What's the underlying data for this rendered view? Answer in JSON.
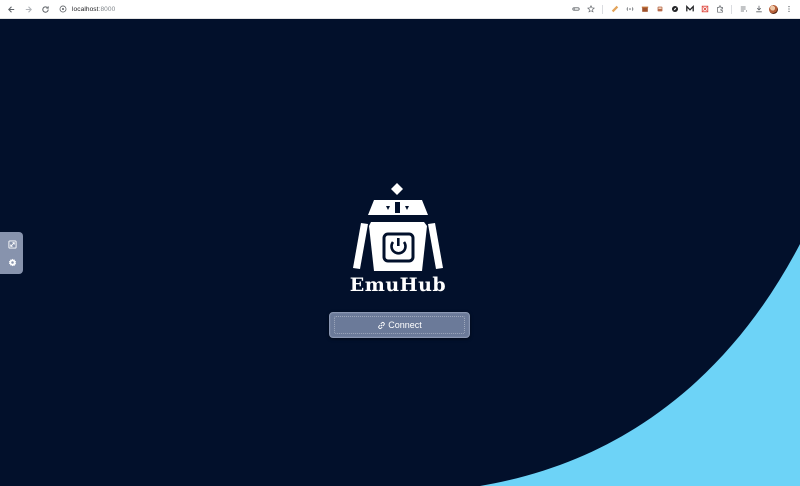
{
  "browser": {
    "url_host": "localhost",
    "url_port": ":8000",
    "icons": {
      "back": "back-arrow-icon",
      "forward": "forward-arrow-icon",
      "reload": "reload-icon",
      "site_info": "site-info-icon",
      "password_key": "key-icon",
      "bookmark": "star-icon",
      "extensions": "puzzle-icon",
      "downloads": "download-icon",
      "menu": "kebab-menu-icon"
    }
  },
  "app": {
    "brand_name": "EmuHub",
    "connect_label": "Connect",
    "colors": {
      "background": "#02102b",
      "wave": "#6dd3f7",
      "button": "#6b7a99",
      "panel": "#8793ad"
    },
    "side_panel": {
      "buttons": [
        "fullscreen-toggle-icon",
        "settings-gear-icon"
      ]
    }
  }
}
